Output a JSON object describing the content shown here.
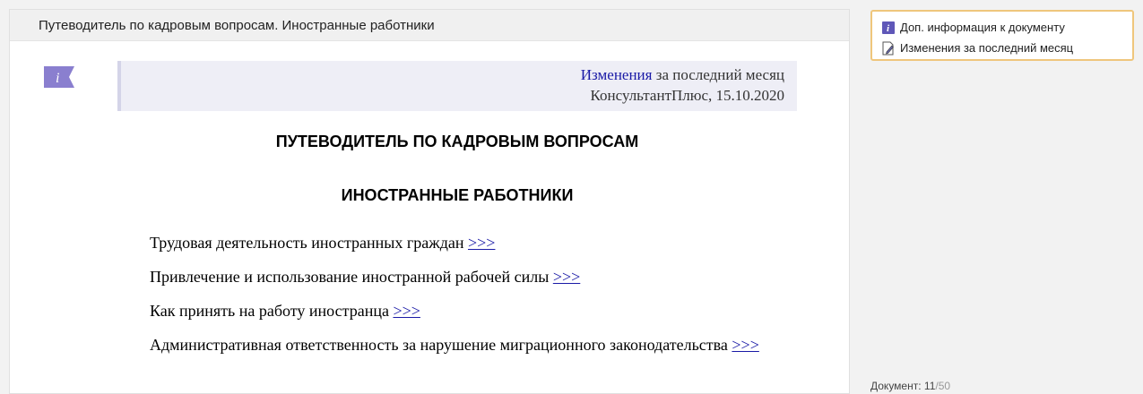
{
  "header": {
    "title": "Путеводитель по кадровым вопросам. Иностранные работники"
  },
  "notice": {
    "link_text": "Изменения",
    "text_after_link": " за последний месяц",
    "source": "КонсультантПлюс, 15.10.2020"
  },
  "document": {
    "title_main": "ПУТЕВОДИТЕЛЬ ПО КАДРОВЫМ ВОПРОСАМ",
    "title_sub": "ИНОСТРАННЫЕ РАБОТНИКИ",
    "toc": [
      {
        "text": "Трудовая деятельность иностранных граждан ",
        "link": ">>>"
      },
      {
        "text": "Привлечение и использование иностранной рабочей силы ",
        "link": ">>>"
      },
      {
        "text": "Как принять на работу иностранца ",
        "link": ">>>"
      },
      {
        "text": "Административная ответственность за нарушение миграционного законодательства ",
        "link": ">>>"
      }
    ]
  },
  "side_panel": {
    "links": [
      {
        "label": "Доп. информация к документу",
        "icon": "info-icon"
      },
      {
        "label": "Изменения за последний месяц",
        "icon": "edit-document-icon"
      }
    ]
  },
  "counter": {
    "label": "Документ: ",
    "current": "11",
    "total": "/50"
  },
  "colors": {
    "link": "#1a1aa6",
    "info_badge": "#7b6fc6",
    "side_border": "#efc67c",
    "notice_bg": "#eeeef6"
  }
}
